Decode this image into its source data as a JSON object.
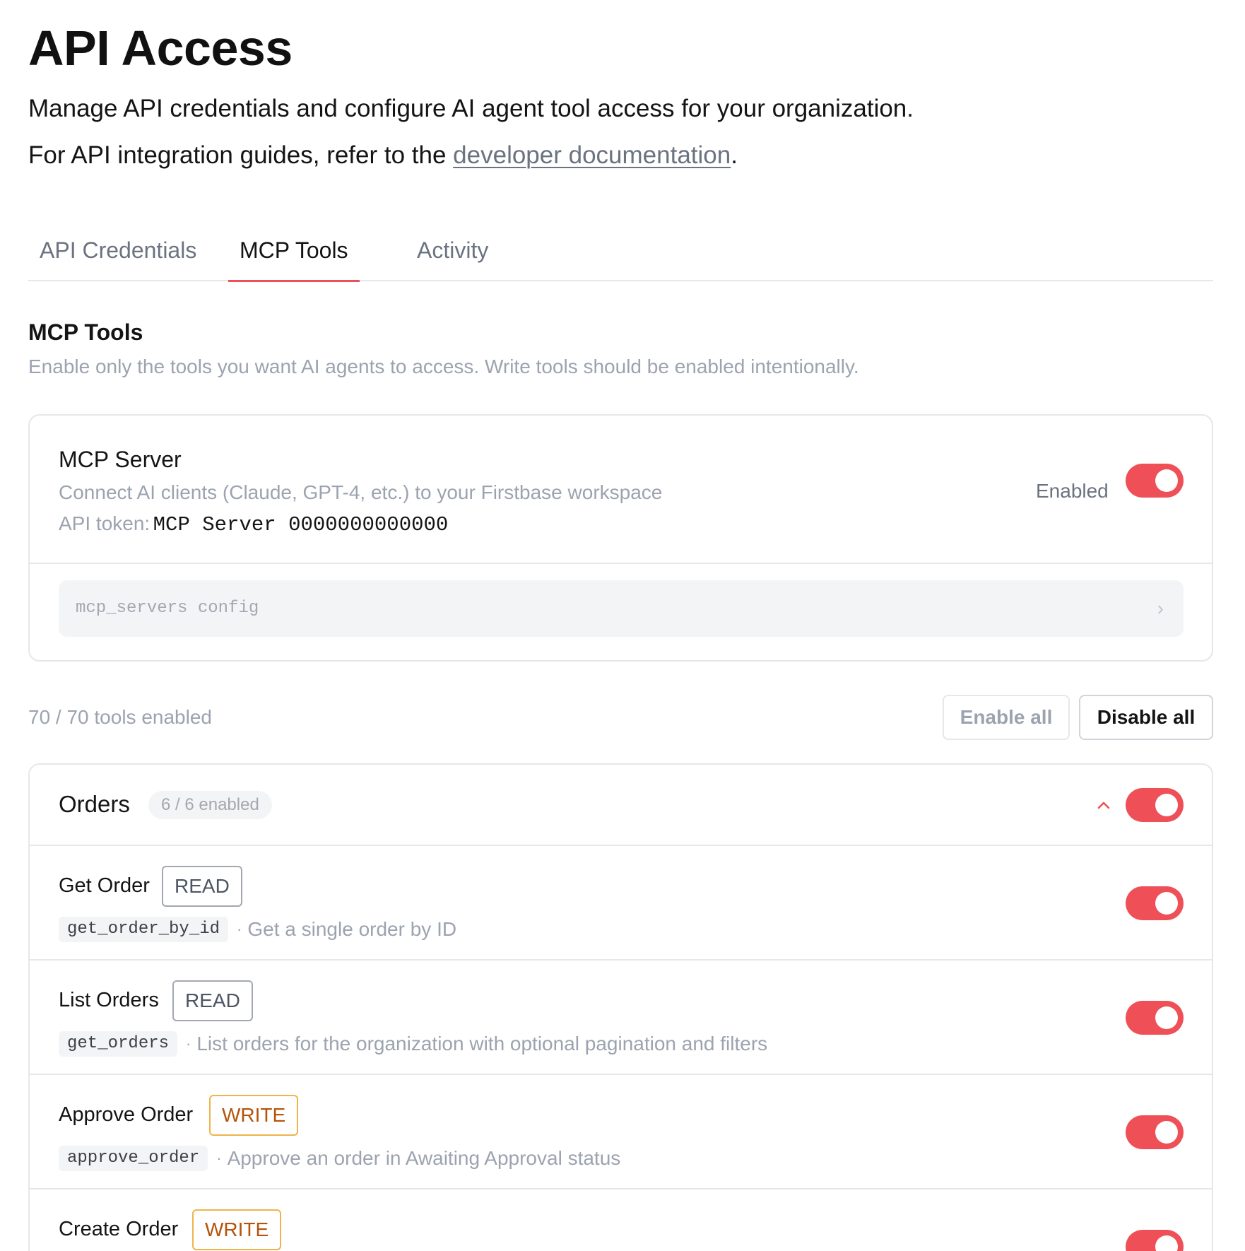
{
  "header": {
    "title": "API Access",
    "intro_line1": "Manage API credentials and configure AI agent tool access for your organization.",
    "intro_line2_prefix": "For API integration guides, refer to the ",
    "intro_line2_link": "developer documentation",
    "intro_line2_suffix": "."
  },
  "tabs": [
    {
      "label": "API Credentials",
      "active": false
    },
    {
      "label": "MCP Tools",
      "active": true
    },
    {
      "label": "Activity",
      "active": false
    }
  ],
  "section": {
    "title": "MCP Tools",
    "subtitle": "Enable only the tools you want AI agents to access. Write tools should be enabled intentionally."
  },
  "server": {
    "name": "MCP Server",
    "description": "Connect AI clients (Claude, GPT-4, etc.) to your Firstbase workspace",
    "token_label": "API token:",
    "token_value": "MCP Server 0000000000000",
    "status_label": "Enabled",
    "enabled": true,
    "config_label": "mcp_servers config"
  },
  "summary": {
    "count_text": "70 / 70 tools enabled",
    "enable_all_label": "Enable all",
    "disable_all_label": "Disable all"
  },
  "group": {
    "name": "Orders",
    "badge": "6 / 6 enabled",
    "expanded": true,
    "enabled": true,
    "tools": [
      {
        "name": "Get Order",
        "access": "READ",
        "id": "get_order_by_id",
        "description": "Get a single order by ID",
        "enabled": true
      },
      {
        "name": "List Orders",
        "access": "READ",
        "id": "get_orders",
        "description": "List orders for the organization with optional pagination and filters",
        "enabled": true
      },
      {
        "name": "Approve Order",
        "access": "WRITE",
        "id": "approve_order",
        "description": "Approve an order in Awaiting Approval status",
        "enabled": true
      },
      {
        "name": "Create Order",
        "access": "WRITE",
        "id": "",
        "description": "",
        "enabled": true
      }
    ]
  },
  "colors": {
    "accent": "#ef4f57",
    "write_badge": "#b45309",
    "muted_text": "#9ca3af"
  }
}
